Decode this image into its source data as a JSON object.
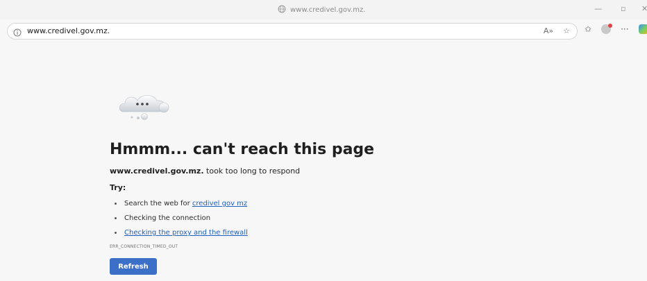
{
  "window": {
    "title": "www.credivel.gov.mz.",
    "minimize_symbol": "—",
    "restore_symbol": "▫",
    "close_symbol": "✕"
  },
  "address_bar": {
    "url": "www.credivel.gov.mz.",
    "read_aloud_label": "A»",
    "favorite_symbol": "☆",
    "favorites_symbol": "✩",
    "more_symbol": "···"
  },
  "error_page": {
    "heading": "Hmmm... can't reach this page",
    "host": "www.credivel.gov.mz.",
    "message": "took too long to respond",
    "try_label": "Try:",
    "suggestions": [
      {
        "prefix": "Search the web for ",
        "link": "credivel gov mz"
      },
      {
        "text": "Checking the connection"
      },
      {
        "link": "Checking the proxy and the firewall"
      }
    ],
    "error_code": "ERR_CONNECTION_TIMED_OUT",
    "refresh_label": "Refresh"
  }
}
